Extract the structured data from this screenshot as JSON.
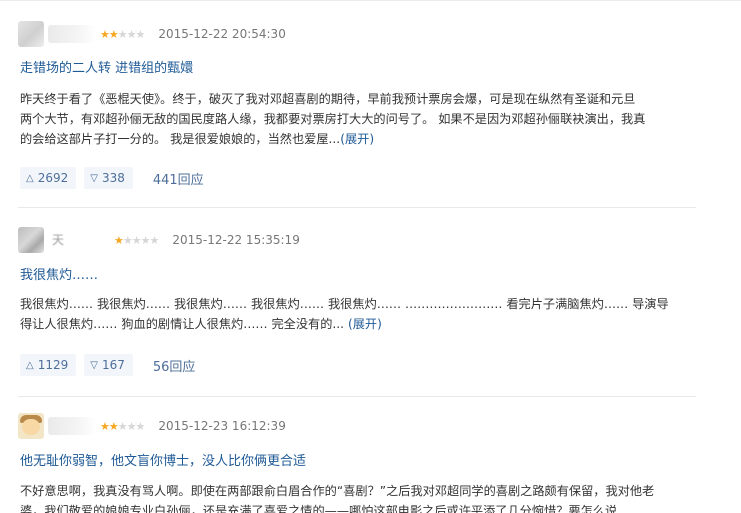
{
  "reviews": [
    {
      "username": "",
      "stars_filled": 2,
      "stars_total": 5,
      "time": "2015-12-22 20:54:30",
      "title": "走错场的二人转 进错组的甄嬛",
      "body_lines": [
        "昨天终于看了《恶棍天使》。终于，破灭了我对邓超喜剧的期待，早前我预计票房会爆，可是现在纵然有圣诞和元旦",
        "两个大节，有邓超孙俪无敌的国民度路人缘，我都要对票房打大大的问号了。 如果不是因为邓超孙俪联袂演出，我真",
        "的会给这部片子打一分的。 我是很爱娘娘的，当然也爱屋..."
      ],
      "expand_label": "(展开)",
      "up_count": "2692",
      "down_count": "338",
      "reply_label": "441回应"
    },
    {
      "username": "天",
      "stars_filled": 1,
      "stars_total": 5,
      "time": "2015-12-22 15:35:19",
      "title": "我很焦灼……",
      "body_lines": [
        "我很焦灼…… 我很焦灼…… 我很焦灼…… 我很焦灼…… 我很焦灼…… ……………………  看完片子满脑焦灼…… 导演导",
        "得让人很焦灼…… 狗血的剧情让人很焦灼…… 完全没有的... "
      ],
      "expand_label": "(展开)",
      "up_count": "1129",
      "down_count": "167",
      "reply_label": "56回应"
    },
    {
      "username": "",
      "stars_filled": 2,
      "stars_total": 5,
      "time": "2015-12-23 16:12:39",
      "title": "他无耻你弱智，他文盲你博士，没人比你俩更合适",
      "body_lines": [
        "不好意思啊，我真没有骂人啊。即使在两部跟俞白眉合作的“喜剧？”之后我对邓超同学的喜剧之路颇有保留，我对他老",
        "婆，我们敬爱的娘娘专业白孙俪，还是充满了喜爱之情的——哪怕这部电影之后或许平添了几分惋惜？要怎么说"
      ],
      "expand_label": "",
      "up_count": "",
      "down_count": "",
      "reply_label": ""
    }
  ],
  "icons": {
    "star": "★",
    "up": "△",
    "down": "▽"
  },
  "colors": {
    "link": "#1f5a96",
    "star_on": "#f5a623",
    "star_off": "#d6d6d6",
    "vote_bg": "#f2f6fb"
  }
}
